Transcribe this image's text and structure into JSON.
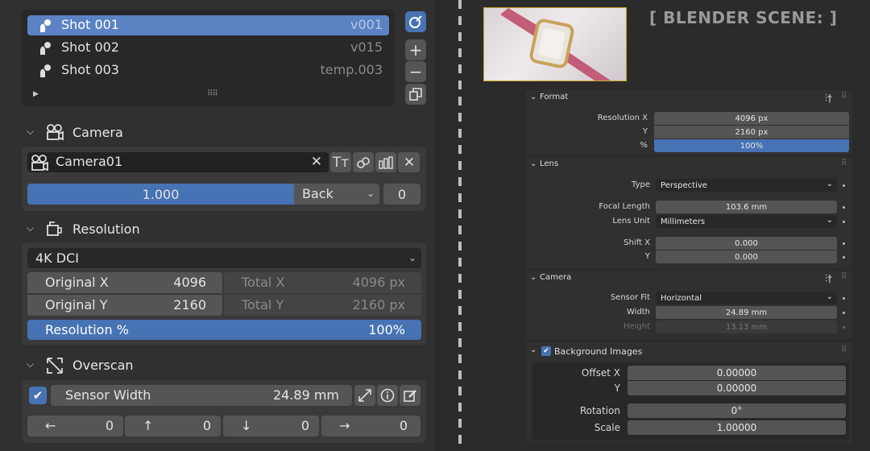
{
  "shots": {
    "items": [
      {
        "name": "Shot 001",
        "version": "v001",
        "selected": true
      },
      {
        "name": "Shot 002",
        "version": "v015",
        "selected": false
      },
      {
        "name": "Shot 003",
        "version": "temp.003",
        "selected": false
      }
    ],
    "add_label": "+",
    "remove_label": "−"
  },
  "camera": {
    "header": "Camera",
    "name": "Camera01",
    "value": "1.000",
    "mode": "Back",
    "mode_count": "0"
  },
  "resolution": {
    "header": "Resolution",
    "preset": "4K DCI",
    "orig_x_label": "Original X",
    "orig_x": "4096",
    "total_x_label": "Total X",
    "total_x": "4096 px",
    "orig_y_label": "Original Y",
    "orig_y": "2160",
    "total_y_label": "Total Y",
    "total_y": "2160 px",
    "pct_label": "Resolution %",
    "pct": "100%"
  },
  "overscan": {
    "header": "Overscan",
    "sensor_label": "Sensor Width",
    "sensor_value": "24.89 mm",
    "left": "0",
    "up": "0",
    "down": "0",
    "right": "0"
  },
  "scene_title": "[ BLENDER SCENE: ]",
  "props": {
    "format": {
      "header": "Format",
      "res_x_label": "Resolution X",
      "res_x": "4096 px",
      "y_label": "Y",
      "res_y": "2160 px",
      "pct_label": "%",
      "pct": "100%"
    },
    "lens": {
      "header": "Lens",
      "type_label": "Type",
      "type": "Perspective",
      "focal_label": "Focal Length",
      "focal": "103.6 mm",
      "unit_label": "Lens Unit",
      "unit": "Millimeters",
      "shift_x_label": "Shift X",
      "shift_x": "0.000",
      "shift_y_label": "Y",
      "shift_y": "0.000"
    },
    "camera": {
      "header": "Camera",
      "fit_label": "Sensor Fit",
      "fit": "Horizontal",
      "width_label": "Width",
      "width": "24.89 mm",
      "height_label": "Height",
      "height": "13.13 mm"
    },
    "bg": {
      "header": "Background Images",
      "offset_x_label": "Offset X",
      "offset_x": "0.00000",
      "y_label": "Y",
      "offset_y": "0.00000",
      "rotation_label": "Rotation",
      "rotation": "0°",
      "scale_label": "Scale",
      "scale": "1.00000"
    }
  }
}
